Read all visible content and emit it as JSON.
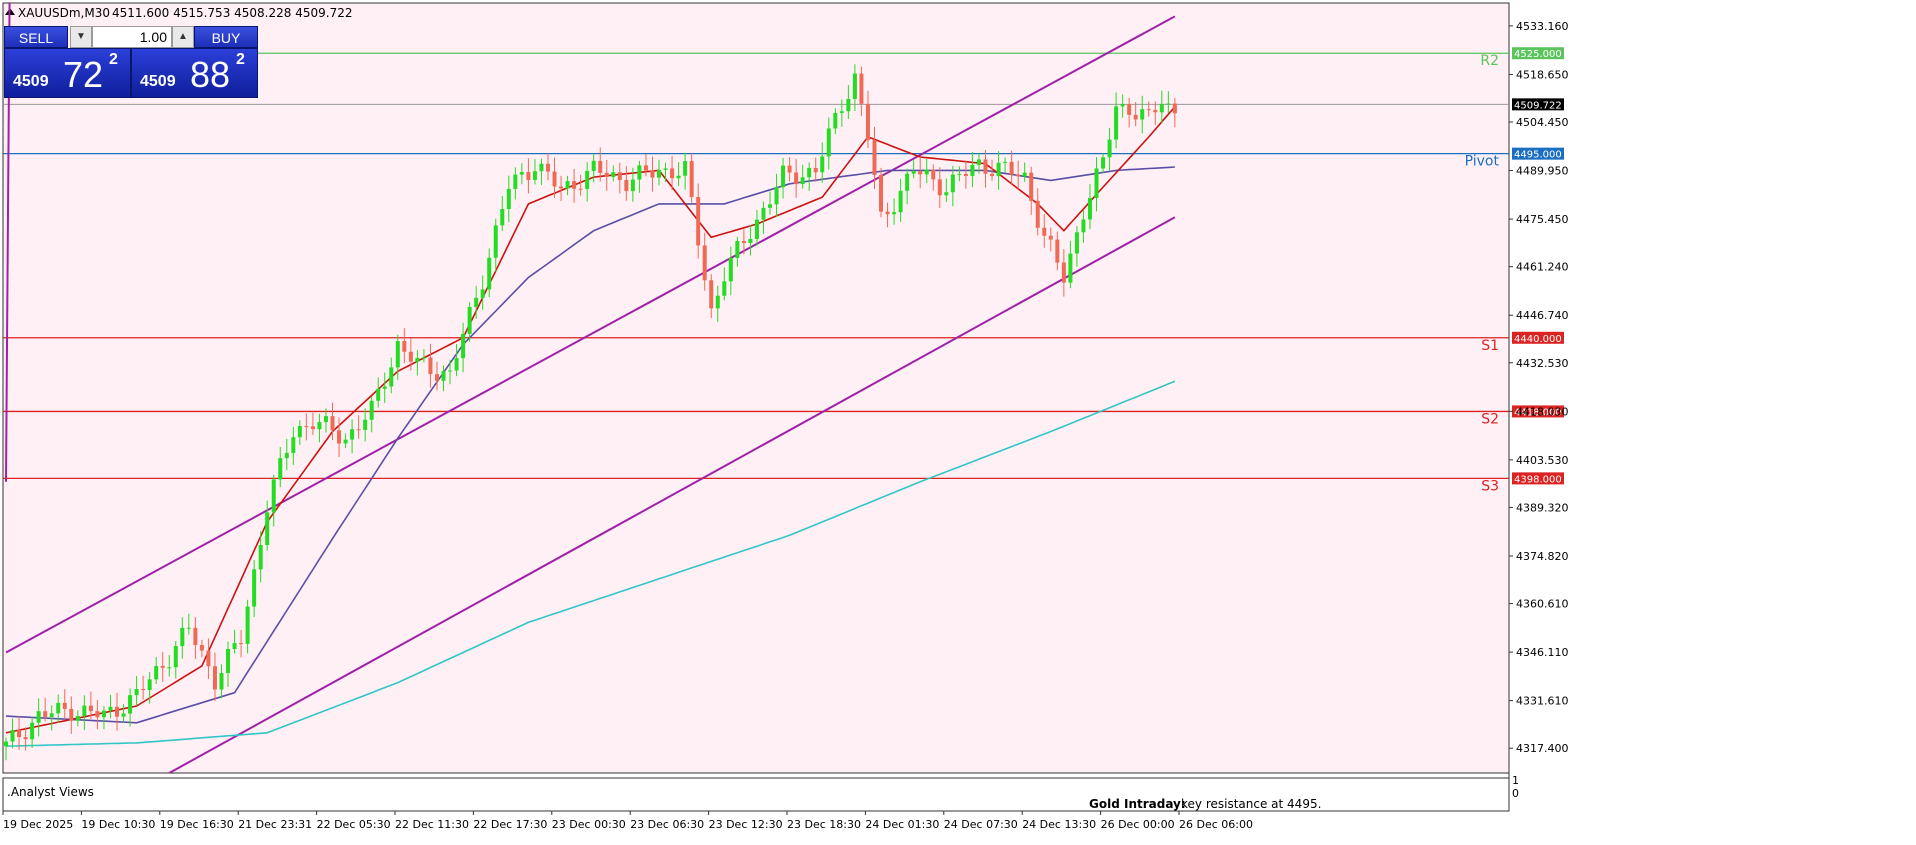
{
  "header": {
    "symbol_line": "XAUUSDm,M30",
    "ohlc": "4511.600 4515.753 4508.228 4509.722"
  },
  "trade_panel": {
    "sell_label": "SELL",
    "buy_label": "BUY",
    "lot_value": "1.00",
    "sell_price_small": "4509",
    "sell_price_big": "72",
    "sell_price_sup": "2",
    "buy_price_small": "4509",
    "buy_price_big": "88",
    "buy_price_sup": "2"
  },
  "indicator_panel": {
    "label": ".Analyst Views",
    "annotation_title": "Gold Intraday:",
    "annotation_text": "key resistance at 4495.",
    "scale_top": "1",
    "scale_bottom": "0"
  },
  "colors": {
    "background": "#fff0f5",
    "up_candle": "#22dd22",
    "down_candle": "#ef6a55",
    "ma_fast": "#cc1111",
    "ma_mid": "#5a4ea8",
    "ma_slow": "#33c6c6",
    "channel": "#a020a8",
    "resistance": "#5cc45c",
    "pivot": "#1a6fc0",
    "support": "#dd2222",
    "price_line": "#999999"
  },
  "chart_data": {
    "type": "candlestick",
    "symbol": "XAUUSDm",
    "timeframe": "M30",
    "ylim": [
      4310.0,
      4540.0
    ],
    "y_ticks": [
      "4533.160",
      "4518.650",
      "4504.450",
      "4489.950",
      "4475.450",
      "4461.240",
      "4446.740",
      "4432.530",
      "4418.030",
      "4403.530",
      "4389.320",
      "4374.820",
      "4360.610",
      "4346.110",
      "4331.610",
      "4317.400"
    ],
    "x_ticks": [
      "19 Dec 2025",
      "19 Dec 10:30",
      "19 Dec 16:30",
      "21 Dec 23:31",
      "22 Dec 05:30",
      "22 Dec 11:30",
      "22 Dec 17:30",
      "23 Dec 00:30",
      "23 Dec 06:30",
      "23 Dec 12:30",
      "23 Dec 18:30",
      "24 Dec 01:30",
      "24 Dec 07:30",
      "24 Dec 13:30",
      "26 Dec 00:00",
      "26 Dec 06:00"
    ],
    "horizontal_levels": [
      {
        "label": "R2",
        "value": 4525.0,
        "tag": "4525.000",
        "kind": "resistance"
      },
      {
        "label": "Pivot",
        "value": 4495.0,
        "tag": "4495.000",
        "kind": "pivot"
      },
      {
        "label": "S1",
        "value": 4440.0,
        "tag": "4440.000",
        "kind": "support"
      },
      {
        "label": "S2",
        "value": 4418.0,
        "tag": "4418.000",
        "kind": "support"
      },
      {
        "label": "S3",
        "value": 4398.0,
        "tag": "4398.000",
        "kind": "support"
      }
    ],
    "current_price": {
      "value": 4509.722,
      "tag": "4509.722"
    },
    "anchors": [
      [
        0,
        4318
      ],
      [
        5,
        4327
      ],
      [
        10,
        4329
      ],
      [
        15,
        4327
      ],
      [
        20,
        4333
      ],
      [
        25,
        4345
      ],
      [
        28,
        4353
      ],
      [
        32,
        4338
      ],
      [
        36,
        4350
      ],
      [
        40,
        4390
      ],
      [
        44,
        4412
      ],
      [
        47,
        4415
      ],
      [
        52,
        4410
      ],
      [
        56,
        4418
      ],
      [
        60,
        4438
      ],
      [
        63,
        4432
      ],
      [
        68,
        4429
      ],
      [
        73,
        4458
      ],
      [
        77,
        4485
      ],
      [
        81,
        4492
      ],
      [
        85,
        4484
      ],
      [
        90,
        4490
      ],
      [
        95,
        4487
      ],
      [
        100,
        4490
      ],
      [
        104,
        4490
      ],
      [
        108,
        4448
      ],
      [
        110,
        4459
      ],
      [
        114,
        4472
      ],
      [
        119,
        4488
      ],
      [
        124,
        4490
      ],
      [
        128,
        4510
      ],
      [
        130,
        4518
      ],
      [
        132,
        4500
      ],
      [
        134,
        4475
      ],
      [
        139,
        4490
      ],
      [
        144,
        4485
      ],
      [
        149,
        4492
      ],
      [
        153,
        4490
      ],
      [
        156,
        4488
      ],
      [
        159,
        4470
      ],
      [
        162,
        4458
      ],
      [
        165,
        4478
      ],
      [
        168,
        4492
      ],
      [
        170,
        4510
      ],
      [
        175,
        4505
      ],
      [
        177,
        4512
      ],
      [
        179,
        4507
      ]
    ],
    "ema_fast_anchors": [
      [
        0,
        4322
      ],
      [
        20,
        4330
      ],
      [
        30,
        4342
      ],
      [
        40,
        4385
      ],
      [
        50,
        4412
      ],
      [
        60,
        4430
      ],
      [
        70,
        4440
      ],
      [
        80,
        4480
      ],
      [
        90,
        4488
      ],
      [
        100,
        4490
      ],
      [
        108,
        4470
      ],
      [
        115,
        4474
      ],
      [
        125,
        4482
      ],
      [
        132,
        4500
      ],
      [
        140,
        4494
      ],
      [
        150,
        4492
      ],
      [
        158,
        4480
      ],
      [
        162,
        4472
      ],
      [
        168,
        4485
      ],
      [
        175,
        4500
      ],
      [
        179,
        4509
      ]
    ],
    "ema_mid_anchors": [
      [
        0,
        4327
      ],
      [
        20,
        4325
      ],
      [
        35,
        4334
      ],
      [
        50,
        4380
      ],
      [
        60,
        4410
      ],
      [
        70,
        4438
      ],
      [
        80,
        4458
      ],
      [
        90,
        4472
      ],
      [
        100,
        4480
      ],
      [
        110,
        4480
      ],
      [
        120,
        4486
      ],
      [
        135,
        4490
      ],
      [
        150,
        4490
      ],
      [
        160,
        4487
      ],
      [
        170,
        4490
      ],
      [
        179,
        4491
      ]
    ],
    "ema_slow_anchors": [
      [
        0,
        4318
      ],
      [
        20,
        4319
      ],
      [
        40,
        4322
      ],
      [
        60,
        4337
      ],
      [
        80,
        4355
      ],
      [
        100,
        4368
      ],
      [
        120,
        4381
      ],
      [
        140,
        4397
      ],
      [
        160,
        4412
      ],
      [
        179,
        4427
      ]
    ],
    "channel_lines": [
      {
        "name": "upper-channel",
        "start": [
          0,
          4397
        ],
        "end": [
          1,
          4660
        ]
      },
      {
        "name": "mid-channel",
        "start": [
          0,
          4346
        ],
        "end": [
          179,
          4536
        ]
      },
      {
        "name": "lower-channel",
        "start": [
          25,
          4310
        ],
        "end": [
          179,
          4476
        ]
      }
    ]
  }
}
